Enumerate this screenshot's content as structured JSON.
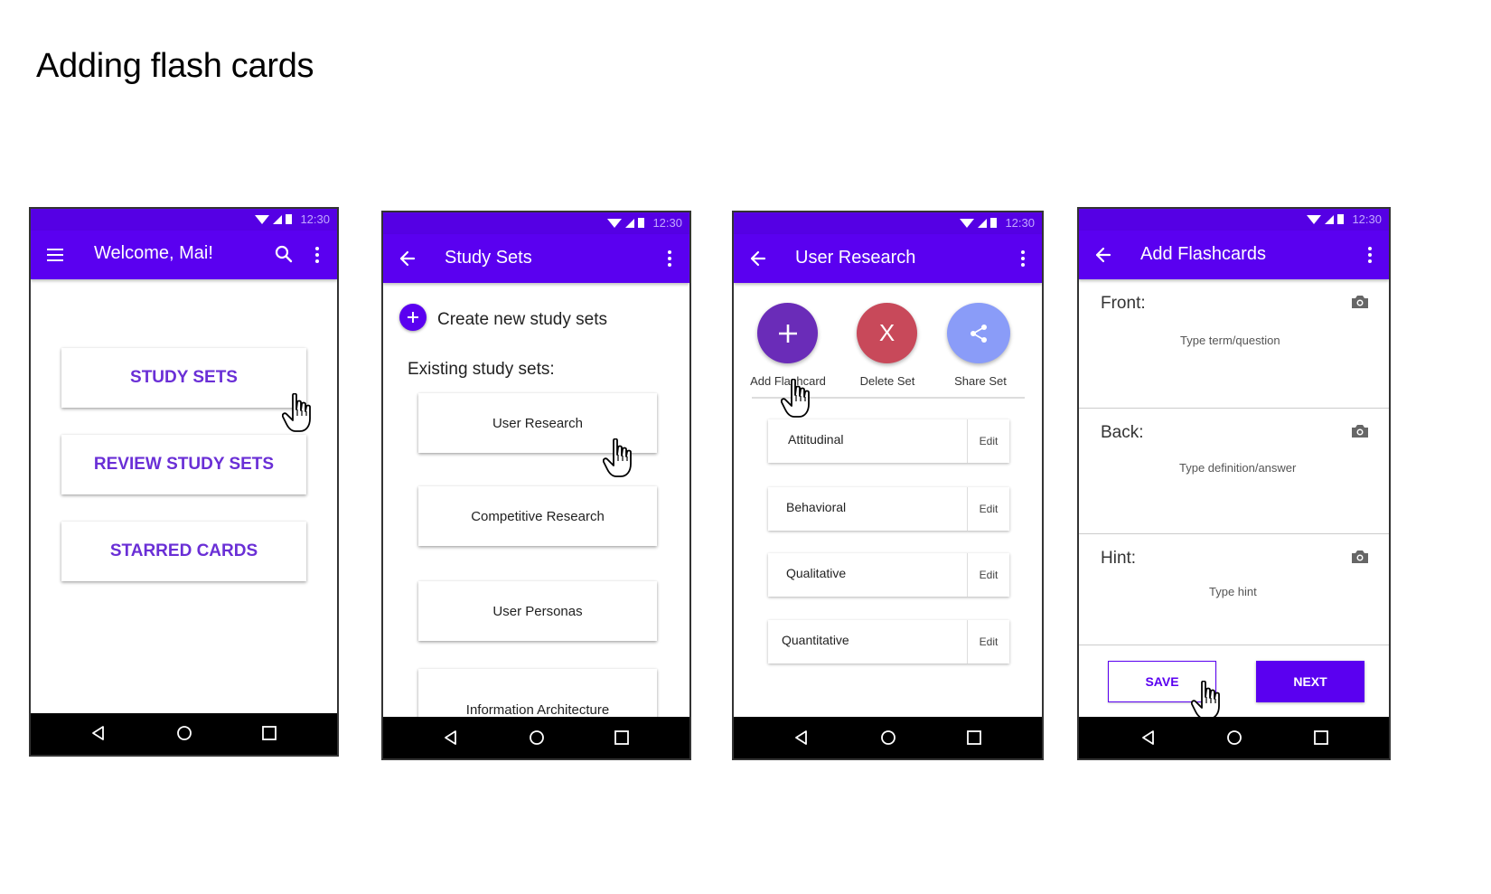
{
  "page": {
    "title": "Adding flash cards"
  },
  "status": {
    "time": "12:30"
  },
  "screen1": {
    "title": "Welcome, Mai!",
    "buttons": [
      "STUDY SETS",
      "REVIEW STUDY SETS",
      "STARRED CARDS"
    ]
  },
  "screen2": {
    "title": "Study Sets",
    "create_label": "Create new study sets",
    "existing_label": "Existing study sets:",
    "sets": [
      "User Research",
      "Competitive Research",
      "User Personas",
      "Information Architecture"
    ]
  },
  "screen3": {
    "title": "User Research",
    "actions": [
      {
        "label": "Add Flashcard",
        "color": "#6a2cb8"
      },
      {
        "label": "Delete Set",
        "color": "#c8495a"
      },
      {
        "label": "Share Set",
        "color": "#8a9cf8"
      }
    ],
    "delete_glyph": "X",
    "items": [
      "Attitudinal",
      "Behavioral",
      "Qualitative",
      "Quantitative"
    ],
    "edit_label": "Edit"
  },
  "screen4": {
    "title": "Add Flashcards",
    "fields": [
      {
        "label": "Front:",
        "placeholder": "Type term/question"
      },
      {
        "label": "Back:",
        "placeholder": "Type definition/answer"
      },
      {
        "label": "Hint:",
        "placeholder": "Type hint"
      }
    ],
    "save_label": "SAVE",
    "next_label": "NEXT"
  },
  "icons": {
    "menu": "hamburger-menu-icon",
    "search": "search-icon",
    "more": "more-vert-icon",
    "back": "arrow-back-icon",
    "camera": "camera-icon",
    "share": "share-icon",
    "add": "plus-icon",
    "pointer": "hand-pointer-icon",
    "nav_back": "nav-back-icon",
    "nav_home": "nav-home-icon",
    "nav_recent": "nav-recent-icon"
  },
  "colors": {
    "status_bar": "#5500e4",
    "app_bar": "#5a00f0",
    "accent_text": "#6a2fd6"
  }
}
